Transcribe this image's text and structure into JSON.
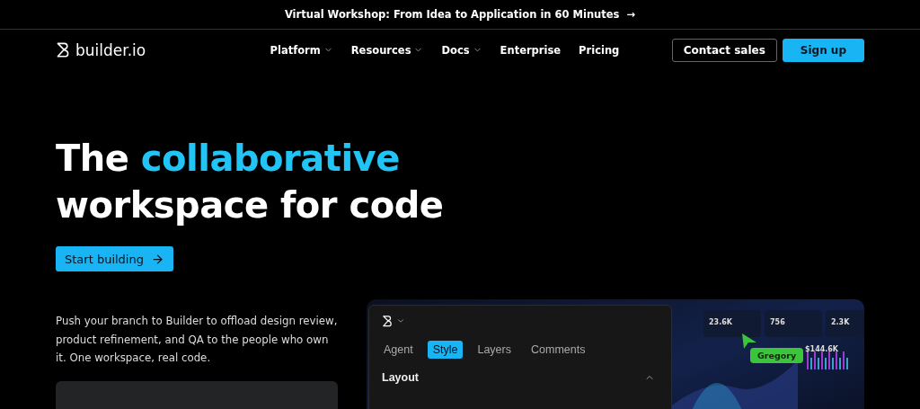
{
  "banner": {
    "text": "Virtual Workshop: From Idea to Application in 60 Minutes",
    "arrow": "→"
  },
  "nav": {
    "logo": "builder.io",
    "links": [
      {
        "label": "Platform",
        "dropdown": true
      },
      {
        "label": "Resources",
        "dropdown": true
      },
      {
        "label": "Docs",
        "dropdown": true
      },
      {
        "label": "Enterprise",
        "dropdown": false
      },
      {
        "label": "Pricing",
        "dropdown": false
      }
    ],
    "buttons": [
      {
        "label": "Contact sales",
        "kind": "outline"
      },
      {
        "label": "Sign up",
        "kind": "primary"
      }
    ]
  },
  "hero": {
    "title_start": "The",
    "title_highlight": "collaborative",
    "title_end": "workspace for code",
    "cta": "Start building",
    "description": "Push your branch to Builder to offload design review, product refinement, and QA to the people who own it. One workspace, real code."
  },
  "editor": {
    "tabs": [
      {
        "label": "Agent",
        "selected": false
      },
      {
        "label": "Style",
        "selected": true
      },
      {
        "label": "Layers",
        "selected": false
      },
      {
        "label": "Comments",
        "selected": false
      }
    ],
    "section": {
      "label": "Layout",
      "expanded": true
    }
  },
  "dashboard": {
    "stats": [
      "23.6K",
      "756",
      "2.3K"
    ],
    "profit": "$144.6K",
    "cursor_label": "Gregory"
  }
}
